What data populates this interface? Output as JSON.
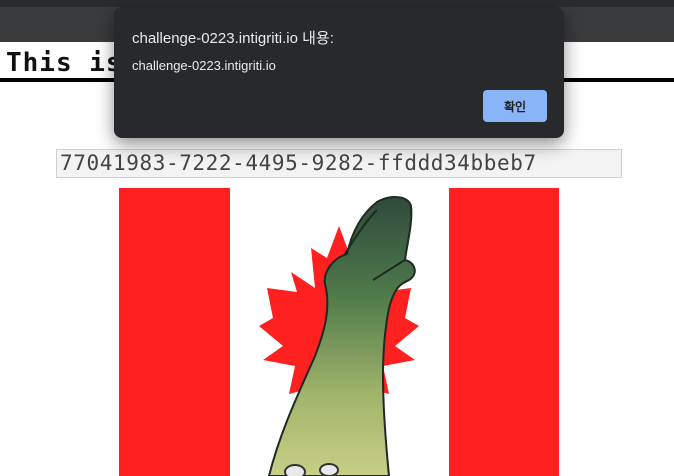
{
  "page": {
    "heading": "This is the \"NFT\"!",
    "uuid": "77041983-7222-4495-9282-ffddd34bbeb7"
  },
  "dialog": {
    "title": "challenge-0223.intigriti.io 내용:",
    "message": "challenge-0223.intigriti.io",
    "ok_label": "확인"
  },
  "colors": {
    "flag_red": "#ff2020",
    "dialog_bg": "#28292c",
    "button_accent": "#8ab4f8"
  }
}
